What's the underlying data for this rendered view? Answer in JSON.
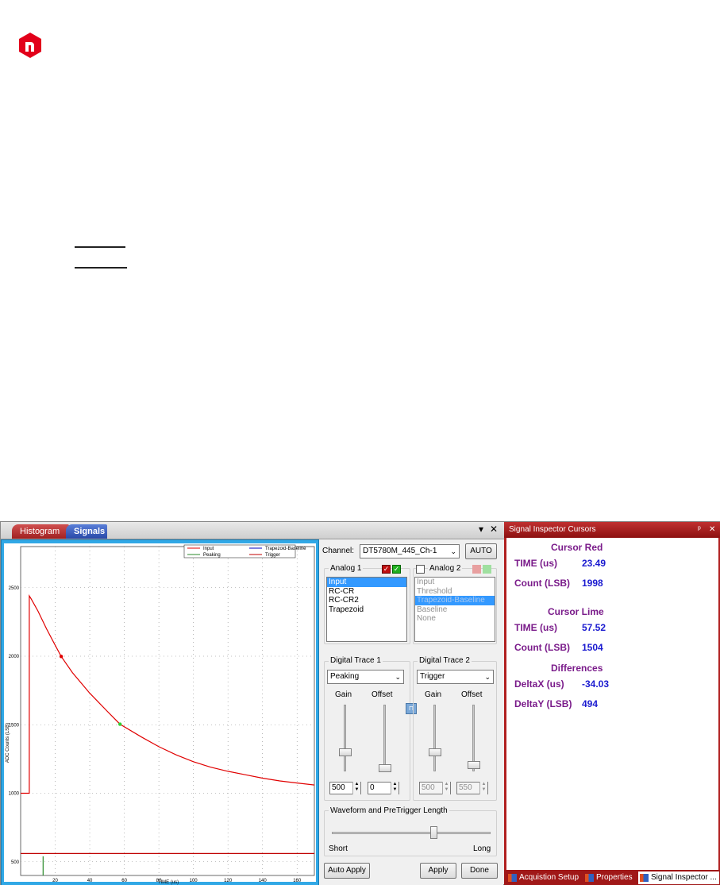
{
  "tabs": {
    "histogram": "Histogram",
    "signals": "Signals"
  },
  "window_buttons": {
    "dropdown": "▾",
    "close": "✕"
  },
  "plot": {
    "ylabel": "ADC Counts (LSB)",
    "xlabel": "TIME (us)",
    "legend": [
      "Input",
      "Trapezoid-Baseline",
      "Peaking",
      "Trigger"
    ]
  },
  "chart_data": {
    "type": "line",
    "xlabel": "TIME (us)",
    "ylabel": "ADC Counts (LSB)",
    "xlim": [
      0,
      170
    ],
    "ylim": [
      400,
      2800
    ],
    "xticks": [
      20,
      40,
      60,
      80,
      100,
      120,
      140,
      160
    ],
    "yticks": [
      500,
      1000,
      1500,
      2000,
      2500
    ],
    "grid": true,
    "legend_position": "top-right",
    "series": [
      {
        "name": "Input",
        "color": "#e00000",
        "x": [
          0,
          3.5,
          5,
          5,
          6,
          10,
          15,
          20,
          23.49,
          30,
          40,
          50,
          57.52,
          70,
          80,
          90,
          100,
          110,
          120,
          130,
          140,
          150,
          160,
          170
        ],
        "y": [
          1000,
          1000,
          1000,
          2440,
          2420,
          2330,
          2200,
          2080,
          1998,
          1880,
          1730,
          1600,
          1504,
          1410,
          1340,
          1280,
          1230,
          1190,
          1160,
          1135,
          1110,
          1090,
          1075,
          1060
        ]
      },
      {
        "name": "Trigger",
        "color": "#c00000",
        "x": [
          0,
          170
        ],
        "y": [
          560,
          560
        ]
      },
      {
        "name": "Peaking",
        "color": "#2a8a2a",
        "x": [
          13,
          13
        ],
        "y": [
          540,
          400
        ]
      }
    ],
    "cursors": [
      {
        "name": "Cursor Red",
        "x": 23.49,
        "y": 1998,
        "color": "#e00000"
      },
      {
        "name": "Cursor Lime",
        "x": 57.52,
        "y": 1504,
        "color": "#32cd32"
      }
    ]
  },
  "controls": {
    "channel_label": "Channel:",
    "channel_value": "DT5780M_445_Ch-1",
    "auto_label": "AUTO",
    "analog1_label": "Analog 1",
    "analog1_items": [
      "Input",
      "RC-CR",
      "RC-CR2",
      "Trapezoid"
    ],
    "analog2_label": "Analog 2",
    "analog2_items": [
      "Input",
      "Threshold",
      "Trapezoid-Baseline",
      "Baseline",
      "None"
    ],
    "digital1_label": "Digital Trace 1",
    "digital1_value": "Peaking",
    "digital2_label": "Digital Trace 2",
    "digital2_value": "Trigger",
    "gain_label": "Gain",
    "offset_label": "Offset",
    "d1_gain": "500",
    "d1_offset": "0",
    "d2_gain": "500",
    "d2_offset": "550",
    "waveform_label": "Waveform and PreTrigger Length",
    "short_label": "Short",
    "long_label": "Long",
    "auto_apply": "Auto Apply",
    "apply": "Apply",
    "done": "Done"
  },
  "inspector": {
    "title": "Signal Inspector Cursors",
    "pin": "ᵖ",
    "close": "✕",
    "cursor_red": {
      "title": "Cursor Red",
      "time_label": "TIME (us)",
      "time": "23.49",
      "count_label": "Count (LSB)",
      "count": "1998"
    },
    "cursor_lime": {
      "title": "Cursor Lime",
      "time_label": "TIME (us)",
      "time": "57.52",
      "count_label": "Count (LSB)",
      "count": "1504"
    },
    "differences": {
      "title": "Differences",
      "dx_label": "DeltaX (us)",
      "dx": "-34.03",
      "dy_label": "DeltaY (LSB)",
      "dy": "494"
    },
    "bottom_tabs": [
      "Acquistion Setup",
      "Properties",
      "Signal Inspector ..."
    ]
  },
  "colors": {
    "brand": "#e2001a",
    "accent_tab": "#2848a8",
    "panel_red": "#a01818"
  }
}
